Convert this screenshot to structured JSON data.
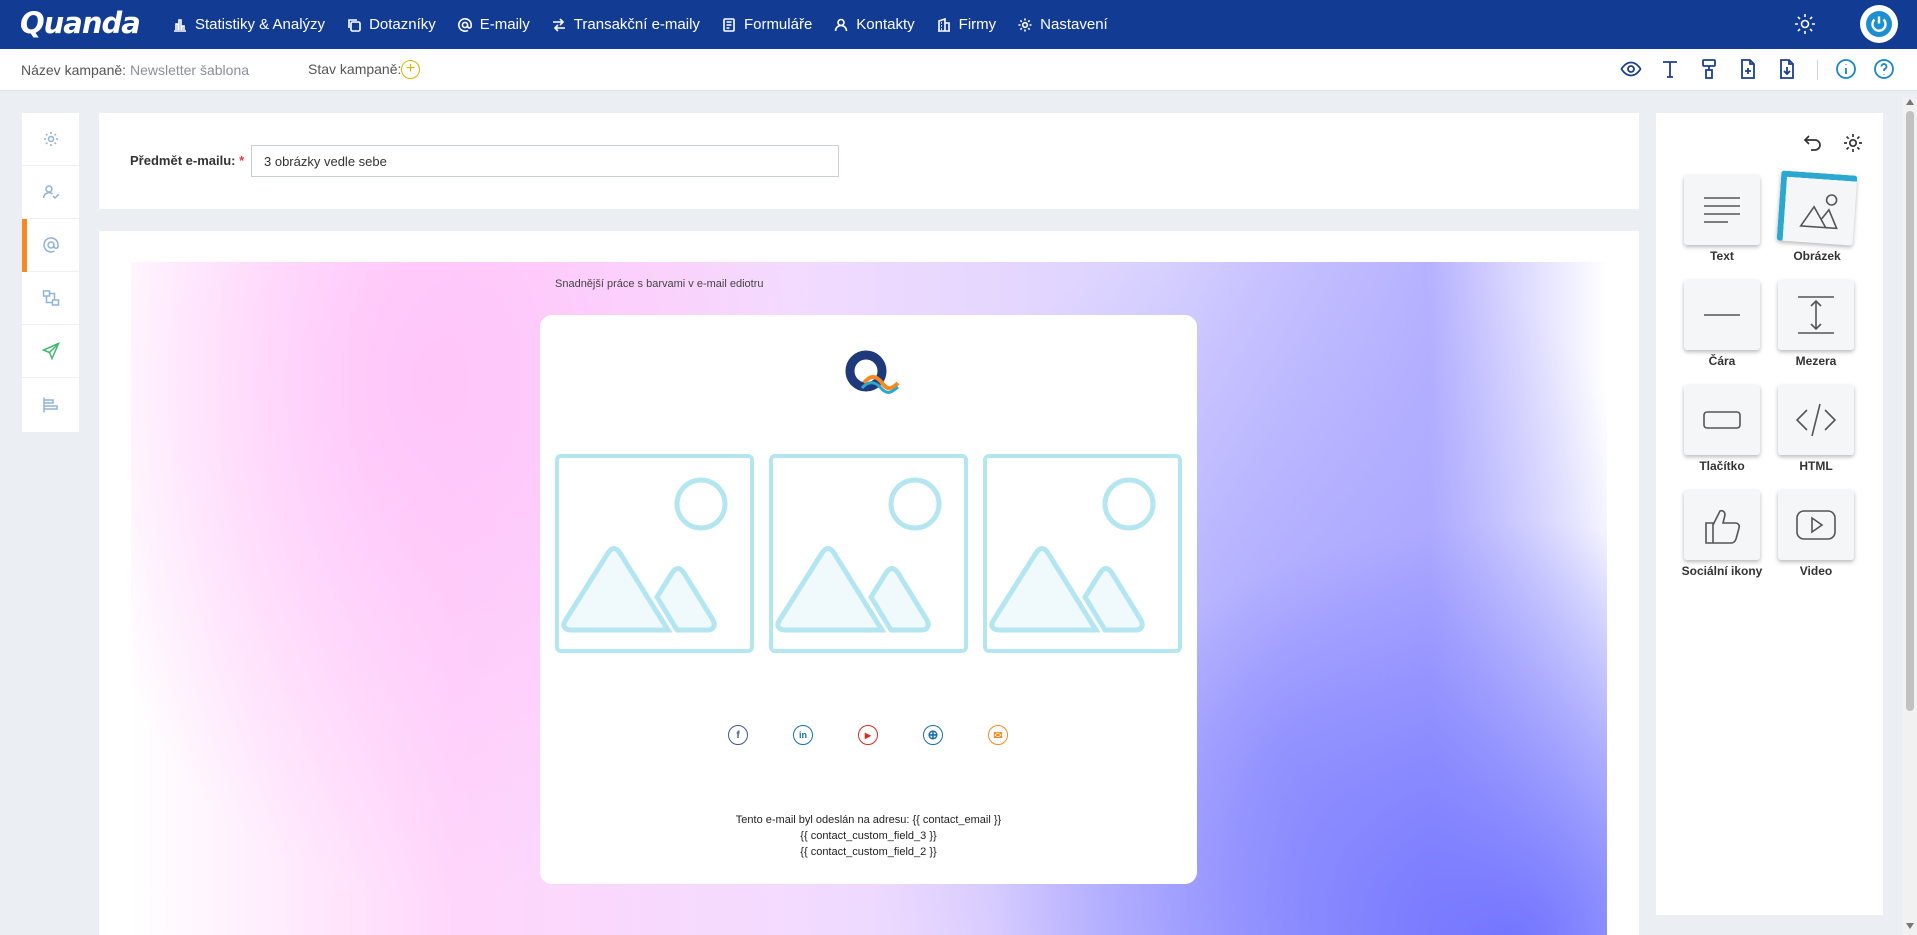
{
  "app": {
    "logo_text": "Quanda",
    "brand_color": "#123b93",
    "accent_color": "#f7891f"
  },
  "nav": {
    "items": [
      {
        "label": "Statistiky & Analýzy",
        "icon": "bar-chart-icon"
      },
      {
        "label": "Dotazníky",
        "icon": "copy-icon"
      },
      {
        "label": "E-maily",
        "icon": "at-icon"
      },
      {
        "label": "Transakční e-maily",
        "icon": "transfer-icon"
      },
      {
        "label": "Formuláře",
        "icon": "form-icon"
      },
      {
        "label": "Kontakty",
        "icon": "user-icon"
      },
      {
        "label": "Firmy",
        "icon": "building-icon"
      },
      {
        "label": "Nastavení",
        "icon": "gear-icon"
      }
    ]
  },
  "campaign": {
    "name_label": "Název kampaně:",
    "name_value": "Newsletter šablona",
    "status_label": "Stav kampaně:",
    "status_add": "+"
  },
  "toolbar": {
    "icons": [
      "eye-icon",
      "text-icon",
      "paint-roller-icon",
      "file-add-icon",
      "file-download-icon",
      "info-icon",
      "help-icon"
    ]
  },
  "sidebar": {
    "items": [
      "settings-icon",
      "user-check-icon",
      "at-icon",
      "workflow-icon",
      "send-icon",
      "align-icon"
    ]
  },
  "subject": {
    "label": "Předmět e-mailu:",
    "required_mark": "*",
    "value": "3 obrázky vedle sebe"
  },
  "email": {
    "preheader": "Snadnější práce s barvami v e-mail ediotru",
    "social": [
      {
        "name": "facebook-icon",
        "glyph": "f",
        "color": "#3b5998"
      },
      {
        "name": "linkedin-icon",
        "glyph": "in",
        "color": "#0e76a8"
      },
      {
        "name": "youtube-icon",
        "glyph": "▶",
        "color": "#d62d20"
      },
      {
        "name": "web-icon",
        "glyph": "⊕",
        "color": "#1c6fa6"
      },
      {
        "name": "mail-icon",
        "glyph": "✉",
        "color": "#f7891f"
      }
    ],
    "footer": {
      "line1": "Tento e-mail byl odeslán na adresu: {{ contact_email }}",
      "line2": "{{ contact_custom_field_3 }}",
      "line3": "{{ contact_custom_field_2 }}"
    }
  },
  "blocks": {
    "items": [
      {
        "label": "Text",
        "icon": "text-lines-icon"
      },
      {
        "label": "Obrázek",
        "icon": "image-icon"
      },
      {
        "label": "Čára",
        "icon": "line-icon"
      },
      {
        "label": "Mezera",
        "icon": "spacer-icon"
      },
      {
        "label": "Tlačítko",
        "icon": "button-icon"
      },
      {
        "label": "HTML",
        "icon": "code-icon"
      },
      {
        "label": "Sociální ikony",
        "icon": "thumbs-up-icon"
      },
      {
        "label": "Video",
        "icon": "video-icon"
      }
    ]
  }
}
